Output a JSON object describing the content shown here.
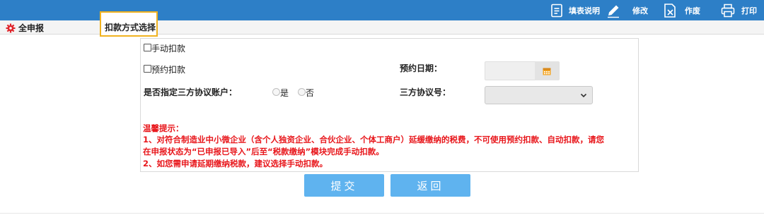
{
  "toolbar": {
    "fill_help": "填表说明",
    "modify": "修改",
    "void": "作废",
    "print": "打印"
  },
  "tabs": {
    "all": "全申报",
    "selected": "扣款方式选择"
  },
  "form": {
    "manual_debit": "手动扣款",
    "scheduled_debit": "预约扣款",
    "scheduled_date_label": "预约日期：",
    "designated_account_label": "是否指定三方协议账户：",
    "yes": "是",
    "no": "否",
    "agreement_no_label": "三方协议号："
  },
  "notice": {
    "title": "温馨提示：",
    "line1": "1、对符合制造业中小微企业（含个人独资企业、合伙企业、个体工商户）延缓缴纳的税费，不可使用预约扣款、自动扣款，请您",
    "line2": "在申报状态为“已申报已导入”后至“税款缴纳”模块完成手动扣款。",
    "line3": "2、如您需申请延期缴纳税款，建议选择手动扣款。"
  },
  "buttons": {
    "submit": "提交",
    "back": "返回"
  },
  "colors": {
    "topbar": "#2d7fc7",
    "button": "#5fb3ef",
    "notice": "#e8161b",
    "tab_highlight": "#f0b21f"
  }
}
